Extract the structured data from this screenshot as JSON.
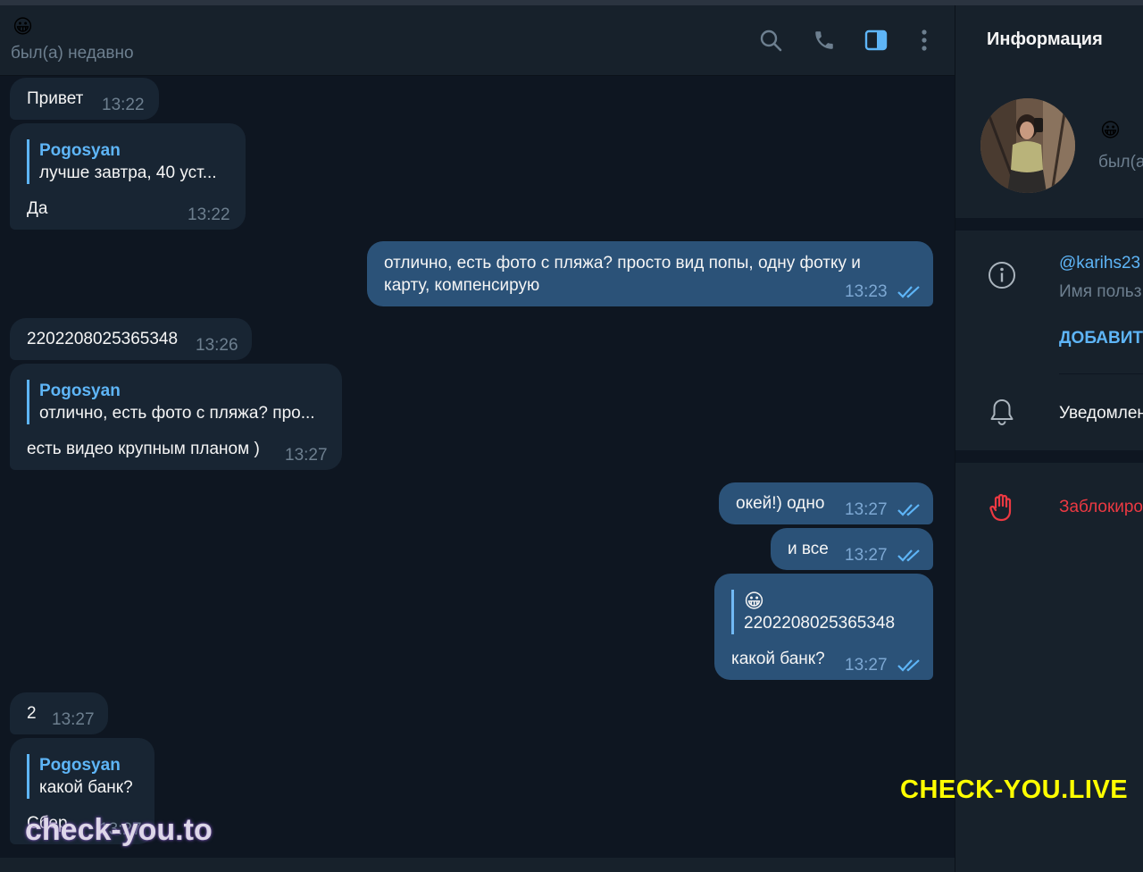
{
  "header": {
    "emoji": "😀",
    "status": "был(а) недавно"
  },
  "messages": [
    {
      "dir": "in",
      "text": "Привет",
      "time": "13:22"
    },
    {
      "dir": "in",
      "quote_name": "Pogosyan",
      "quote_text": "лучше завтра, 40 уст...",
      "text": "Да",
      "time": "13:22"
    },
    {
      "dir": "out",
      "text_line1": "отлично, есть фото с пляжа? просто вид попы, одну фотку и",
      "text_line2": "карту, компенсирую",
      "time": "13:23"
    },
    {
      "dir": "in",
      "text": "2202208025365348",
      "time": "13:26"
    },
    {
      "dir": "in",
      "quote_name": "Pogosyan",
      "quote_text": "отлично, есть фото с пляжа? про...",
      "text": "есть видео крупным планом )",
      "time": "13:27"
    },
    {
      "dir": "out",
      "text": "окей!) одно",
      "time": "13:27"
    },
    {
      "dir": "out",
      "text": "и все",
      "time": "13:27"
    },
    {
      "dir": "out",
      "quote_emoji": "😀",
      "quote_text": "2202208025365348",
      "text": "какой банк?",
      "time": "13:27"
    },
    {
      "dir": "in",
      "text": "2",
      "time": "13:27"
    },
    {
      "dir": "in",
      "quote_name": "Pogosyan",
      "quote_text": "какой банк?",
      "text": "Сбер",
      "time": "13:27"
    }
  ],
  "sidebar": {
    "title": "Информация",
    "emoji": "😀",
    "status": "был(а",
    "username": "@karihs23",
    "username_label": "Имя польз",
    "add_button": "ДОБАВИТЬ",
    "notifications": "Уведомлен",
    "block": "Заблокиро"
  },
  "watermarks": {
    "yellow": "CHECK-YOU.LIVE",
    "white": "check-you.to"
  },
  "icons": [
    "search-icon",
    "phone-icon",
    "sidebar-toggle-icon",
    "more-vertical-icon",
    "info-icon",
    "bell-icon",
    "hand-block-icon",
    "double-check-icon"
  ],
  "colors": {
    "accent": "#5eb5f7",
    "incoming_bubble": "#182533",
    "outgoing_bubble": "#2b5278",
    "danger": "#ec3942",
    "watermark_yellow": "#ffff00"
  }
}
